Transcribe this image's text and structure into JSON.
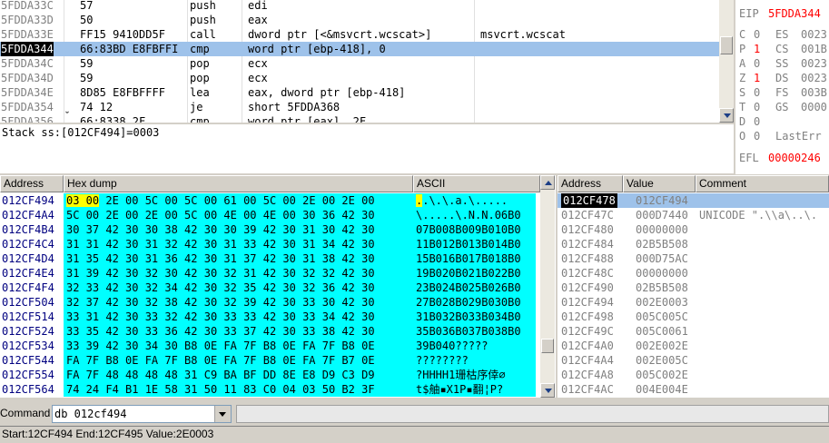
{
  "disasm": {
    "rows": [
      {
        "addr": "5FDDA33C",
        "bytes": "57",
        "mnem": "push",
        "ops": "edi",
        "comment": ""
      },
      {
        "addr": "5FDDA33D",
        "bytes": "50",
        "mnem": "push",
        "ops": "eax",
        "comment": ""
      },
      {
        "addr": "5FDDA33E",
        "bytes": "FF15 9410DD5F",
        "mnem": "call",
        "ops": "dword ptr [<&msvcrt.wcscat>]",
        "comment": "msvcrt.wcscat"
      },
      {
        "addr": "5FDDA344",
        "bytes": "66:83BD E8FBFFI",
        "mnem": "cmp",
        "ops": "word ptr [ebp-418], 0",
        "comment": ""
      },
      {
        "addr": "5FDDA34C",
        "bytes": "59",
        "mnem": "pop",
        "ops": "ecx",
        "comment": ""
      },
      {
        "addr": "5FDDA34D",
        "bytes": "59",
        "mnem": "pop",
        "ops": "ecx",
        "comment": ""
      },
      {
        "addr": "5FDDA34E",
        "bytes": "8D85 E8FBFFFF",
        "mnem": "lea",
        "ops": "eax, dword ptr [ebp-418]",
        "comment": ""
      },
      {
        "addr": "5FDDA354",
        "bytes": "74 12",
        "mnem": "je",
        "ops": "short 5FDDA368",
        "comment": ""
      },
      {
        "addr": "5FDDA356",
        "bytes": "66:8338 2F",
        "mnem": "cmp",
        "ops": "word ptr [eax], 2F",
        "comment": ""
      }
    ],
    "jump_marker": "ˬ"
  },
  "registers": {
    "eip_label": "EIP",
    "eip_value": "5FDDA344",
    "flags": [
      {
        "f": "C",
        "v": "0",
        "seg": "ES",
        "sv": "0023"
      },
      {
        "f": "P",
        "v": "1",
        "seg": "CS",
        "sv": "001B"
      },
      {
        "f": "A",
        "v": "0",
        "seg": "SS",
        "sv": "0023"
      },
      {
        "f": "Z",
        "v": "1",
        "seg": "DS",
        "sv": "0023"
      },
      {
        "f": "S",
        "v": "0",
        "seg": "FS",
        "sv": "003B"
      },
      {
        "f": "T",
        "v": "0",
        "seg": "GS",
        "sv": "0000"
      },
      {
        "f": "D",
        "v": "0",
        "seg": "",
        "sv": ""
      },
      {
        "f": "O",
        "v": "0",
        "seg": "LastErr",
        "sv": ""
      }
    ],
    "efl_label": "EFL",
    "efl_value": "00000246"
  },
  "info": {
    "text": "Stack ss:[012CF494]=0003"
  },
  "dump": {
    "headers": {
      "address": "Address",
      "hex": "Hex dump",
      "ascii": "ASCII"
    },
    "rows": [
      {
        "addr": "012CF494",
        "hex_first": "03 00",
        "hex": " 2E 00 5C 00 5C 00 61 00 5C 00 2E 00 2E 00",
        "ascii_first": ".",
        "ascii": ".\\.\\.a.\\....."
      },
      {
        "addr": "012CF4A4",
        "hex_first": "",
        "hex": "5C 00 2E 00 2E 00 5C 00 4E 00 4E 00 30 36 42 30",
        "ascii_first": "",
        "ascii": "\\.....\\.N.N.06B0"
      },
      {
        "addr": "012CF4B4",
        "hex_first": "",
        "hex": "30 37 42 30 30 38 42 30 30 39 42 30 31 30 42 30",
        "ascii_first": "",
        "ascii": "07B008B009B010B0"
      },
      {
        "addr": "012CF4C4",
        "hex_first": "",
        "hex": "31 31 42 30 31 32 42 30 31 33 42 30 31 34 42 30",
        "ascii_first": "",
        "ascii": "11B012B013B014B0"
      },
      {
        "addr": "012CF4D4",
        "hex_first": "",
        "hex": "31 35 42 30 31 36 42 30 31 37 42 30 31 38 42 30",
        "ascii_first": "",
        "ascii": "15B016B017B018B0"
      },
      {
        "addr": "012CF4E4",
        "hex_first": "",
        "hex": "31 39 42 30 32 30 42 30 32 31 42 30 32 32 42 30",
        "ascii_first": "",
        "ascii": "19B020B021B022B0"
      },
      {
        "addr": "012CF4F4",
        "hex_first": "",
        "hex": "32 33 42 30 32 34 42 30 32 35 42 30 32 36 42 30",
        "ascii_first": "",
        "ascii": "23B024B025B026B0"
      },
      {
        "addr": "012CF504",
        "hex_first": "",
        "hex": "32 37 42 30 32 38 42 30 32 39 42 30 33 30 42 30",
        "ascii_first": "",
        "ascii": "27B028B029B030B0"
      },
      {
        "addr": "012CF514",
        "hex_first": "",
        "hex": "33 31 42 30 33 32 42 30 33 33 42 30 33 34 42 30",
        "ascii_first": "",
        "ascii": "31B032B033B034B0"
      },
      {
        "addr": "012CF524",
        "hex_first": "",
        "hex": "33 35 42 30 33 36 42 30 33 37 42 30 33 38 42 30",
        "ascii_first": "",
        "ascii": "35B036B037B038B0"
      },
      {
        "addr": "012CF534",
        "hex_first": "",
        "hex": "33 39 42 30 34 30 B8 0E FA 7F B8 0E FA 7F B8 0E",
        "ascii_first": "",
        "ascii": "39B040?????"
      },
      {
        "addr": "012CF544",
        "hex_first": "",
        "hex": "FA 7F B8 0E FA 7F B8 0E FA 7F B8 0E FA 7F B7 0E",
        "ascii_first": "",
        "ascii": "????????"
      },
      {
        "addr": "012CF554",
        "hex_first": "",
        "hex": "FA 7F 48 48 48 48 31 C9 BA BF DD 8E E8 D9 C3 D9",
        "ascii_first": "",
        "ascii": "?HHHH1珊枯序倖∅"
      },
      {
        "addr": "012CF564",
        "hex_first": "",
        "hex": "74 24 F4 B1 1E 58 31 50 11 83 C0 04 03 50 B2 3F",
        "ascii_first": "",
        "ascii": "t$舳▪X1P▪翻¦P?"
      }
    ]
  },
  "stack": {
    "headers": {
      "address": "Address",
      "value": "Value",
      "comment": "Comment"
    },
    "rows": [
      {
        "addr": "012CF478",
        "val": "012CF494",
        "com": ""
      },
      {
        "addr": "012CF47C",
        "val": "000D7440",
        "com": "UNICODE \".\\\\a\\..\\."
      },
      {
        "addr": "012CF480",
        "val": "00000000",
        "com": ""
      },
      {
        "addr": "012CF484",
        "val": "02B5B508",
        "com": ""
      },
      {
        "addr": "012CF488",
        "val": "000D75AC",
        "com": ""
      },
      {
        "addr": "012CF48C",
        "val": "00000000",
        "com": ""
      },
      {
        "addr": "012CF490",
        "val": "02B5B508",
        "com": ""
      },
      {
        "addr": "012CF494",
        "val": "002E0003",
        "com": ""
      },
      {
        "addr": "012CF498",
        "val": "005C005C",
        "com": ""
      },
      {
        "addr": "012CF49C",
        "val": "005C0061",
        "com": ""
      },
      {
        "addr": "012CF4A0",
        "val": "002E002E",
        "com": ""
      },
      {
        "addr": "012CF4A4",
        "val": "002E005C",
        "com": ""
      },
      {
        "addr": "012CF4A8",
        "val": "005C002E",
        "com": ""
      },
      {
        "addr": "012CF4AC",
        "val": "004E004E",
        "com": ""
      }
    ]
  },
  "command": {
    "label": "Command",
    "value": "db 012cf494"
  },
  "status": {
    "text": "Start:12CF494 End:12CF495 Value:2E0003"
  },
  "colors": {
    "selection": "#9ec2ea",
    "dump_bg": "#00ffff",
    "highlight": "#ffff00",
    "red": "#ff0000"
  }
}
